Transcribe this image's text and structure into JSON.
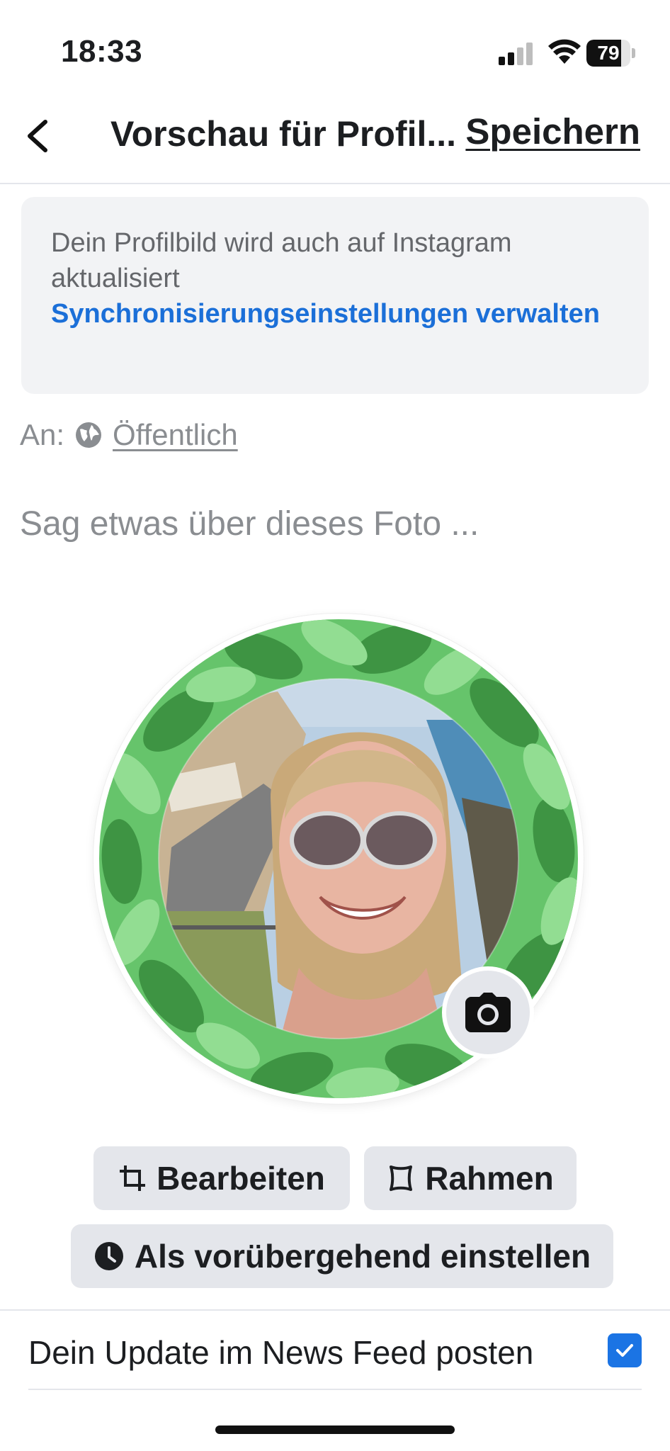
{
  "status_bar": {
    "time": "18:33",
    "battery_level": "79",
    "battery_fraction": 0.79
  },
  "nav": {
    "title": "Vorschau für Profil...",
    "save_label": "Speichern",
    "back_icon": "chevron-left-icon"
  },
  "notice": {
    "text": "Dein Profilbild wird auch auf Instagram aktualisiert",
    "link": "Synchronisierungseinstellungen verwalten"
  },
  "audience": {
    "label": "An:",
    "value": "Öffentlich",
    "icon": "globe-icon"
  },
  "caption_placeholder": "Sag etwas über dieses Foto ...",
  "photo": {
    "frame_color": "#66c46b",
    "camera_icon": "camera-icon"
  },
  "buttons": {
    "edit": "Bearbeiten",
    "frame": "Rahmen",
    "temporary": "Als vorübergehend einstellen"
  },
  "feed": {
    "label": "Dein Update im News Feed posten",
    "checked": true
  },
  "colors": {
    "link_blue": "#1b6fd8",
    "checkbox_blue": "#1b74e4",
    "button_gray": "#e4e6eb",
    "notice_bg": "#f2f3f5"
  }
}
